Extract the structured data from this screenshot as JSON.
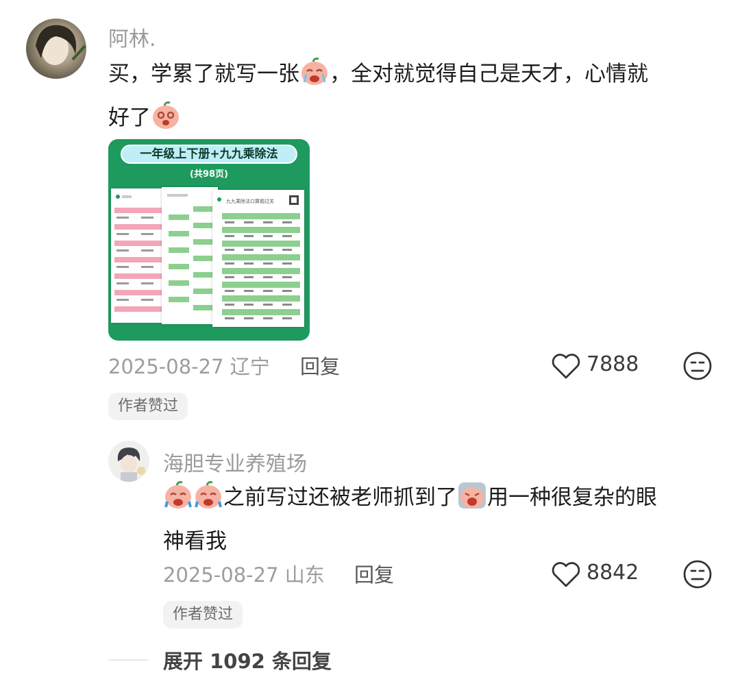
{
  "comment": {
    "username": "阿林.",
    "text_line1_a": "买，学累了就写一张",
    "text_line1_b": "，全对就觉得自己是天才，心情就",
    "text_line2": "好了",
    "image": {
      "title": "一年级上下册+九九乘除法",
      "subtitle": "(共98页)",
      "sheet3_title": "九九乘除法口算题过关"
    },
    "date": "2025-08-27",
    "location": "辽宁",
    "reply_label": "回复",
    "likes": "7888",
    "badge": "作者赞过"
  },
  "reply": {
    "username": "海胆专业养殖场",
    "text_line1": "之前写过还被老师抓到了",
    "text_line1_b": "用一种很复杂的眼",
    "text_line2": "神看我",
    "date": "2025-08-27",
    "location": "山东",
    "reply_label": "回复",
    "likes": "8842",
    "badge": "作者赞过"
  },
  "expand_replies": "展开 1092 条回复",
  "icons": {
    "like": "heart-outline-icon",
    "dislike": "meh-face-icon"
  },
  "colors": {
    "green": "#1e9a5e",
    "pink_row": "#f4a6b8",
    "green_row": "#8ccf8f",
    "title_pill": "#bfeef6"
  }
}
